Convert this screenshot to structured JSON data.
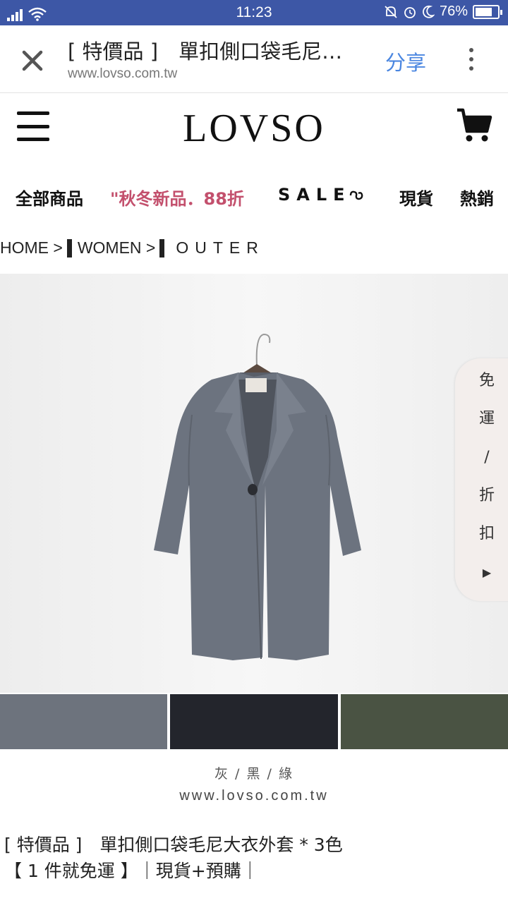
{
  "status_bar": {
    "time": "11:23",
    "battery": "76%",
    "battery_level": 0.76,
    "color": "#3d57a6"
  },
  "browser": {
    "page_title": "[ 特價品 ]　單扣側口袋毛尼…",
    "url": "www.lovso.com.tw",
    "share_label": "分享",
    "close_icon": "close-icon",
    "more_icon": "more-vert-icon",
    "share_color": "#4a86e0"
  },
  "header": {
    "logo": "LOVSO",
    "menu_icon": "hamburger-icon",
    "cart_icon": "cart-icon"
  },
  "nav": {
    "items": [
      {
        "label": "全部商品"
      },
      {
        "label": "\"秋冬新品．88折",
        "color": "#c3506d"
      },
      {
        "label": "SALE"
      },
      {
        "label": "現貨"
      },
      {
        "label": "熱銷"
      }
    ]
  },
  "breadcrumb": {
    "home": "HOME >",
    "women": "WOMEN >",
    "outer": "OUTER"
  },
  "side_tab": {
    "chars": [
      "免",
      "運",
      "/",
      "折",
      "扣",
      "▶"
    ]
  },
  "swatch_colors": [
    "#6d737d",
    "#23252c",
    "#4a5343"
  ],
  "image_text": {
    "colors": "灰 / 黑 / 綠",
    "site": "www.lovso.com.tw"
  },
  "product": {
    "title": "[ 特價品 ]　單扣側口袋毛尼大衣外套 * 3色",
    "subtitle": "【 1 件就免運 】｜現貨+預購｜"
  }
}
